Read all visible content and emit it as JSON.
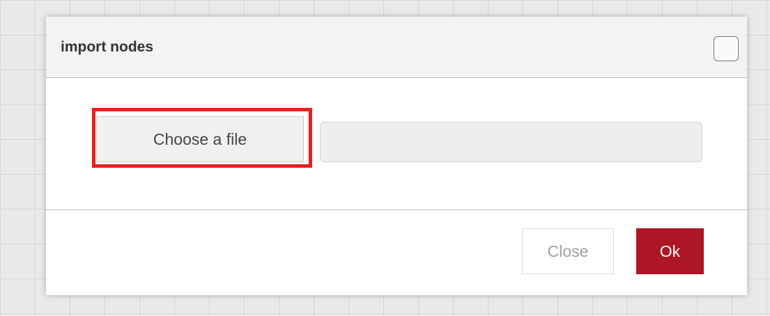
{
  "dialog": {
    "title": "import nodes",
    "header_checkbox_checked": false
  },
  "file_picker": {
    "choose_button_label": "Choose a file",
    "file_name_value": "",
    "highlighted": true,
    "highlight_color": "#e5211d"
  },
  "footer": {
    "close_label": "Close",
    "ok_label": "Ok",
    "ok_color": "#ad1625"
  }
}
